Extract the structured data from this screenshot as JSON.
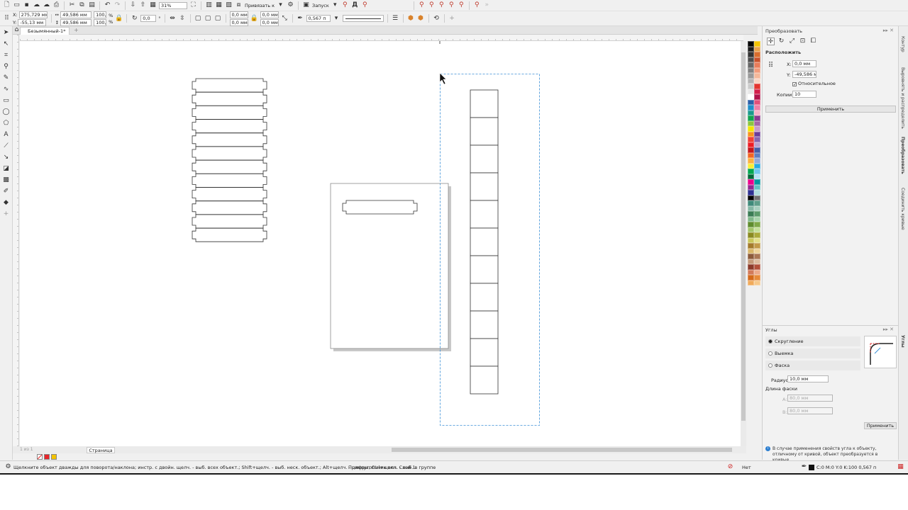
{
  "toolbar1": {
    "zoom": "31%",
    "snap_label": "Привязать к",
    "launch_label": "Запуск"
  },
  "toolbar2": {
    "x_value": "275,729 мм",
    "y_value": "-55,13 мм",
    "width_value": "49,586 мм",
    "height_value": "49,586 мм",
    "scale_w": "100,0",
    "scale_h": "100,0",
    "percent": "%",
    "angle": "0,0",
    "angle_unit": "°",
    "corner1": "0,0 мм",
    "corner2": "0,0 мм",
    "corner3": "0,0 мм",
    "corner4": "0,0 мм",
    "outline_width": "0,567 п"
  },
  "document": {
    "tab_title": "Безымянный-1*",
    "page_tab": "Страница 1",
    "page_nav": "1 из 1"
  },
  "palette_colors": [
    "#000000",
    "#f2c200",
    "#1a1a1a",
    "#e8a04a",
    "#333333",
    "#d96c2c",
    "#4d4d4d",
    "#c8502a",
    "#666666",
    "#e87c5a",
    "#808080",
    "#f09a7a",
    "#999999",
    "#f4b89a",
    "#b3b3b3",
    "#f8d4c4",
    "#cccccc",
    "#e3342f",
    "#e6e6e6",
    "#d21e4a",
    "#ffffff",
    "#b0124a",
    "#2b5fa8",
    "#e14f7a",
    "#1e8fc9",
    "#ee7fa8",
    "#1a9a8c",
    "#f6b3c9",
    "#12a350",
    "#8a3b8f",
    "#8cc63f",
    "#a566a5",
    "#f3e600",
    "#c89fc9",
    "#f7941d",
    "#6a3d99",
    "#ef4136",
    "#8766b0",
    "#ed1c24",
    "#b9a3d1",
    "#c4161c",
    "#445ea8",
    "#f26522",
    "#5e7fc1",
    "#fbb040",
    "#93a9da",
    "#f9ed32",
    "#27aae1",
    "#00a651",
    "#71c8ed",
    "#006838",
    "#b7e2f5",
    "#ec008c",
    "#0098a0",
    "#92278f",
    "#61c2c2",
    "#2e3192",
    "#b0dede",
    "#000000",
    "#707070",
    "#3f8a7a",
    "#5f9e8a",
    "#84b7a4",
    "#a9d0c0",
    "#3a7c54",
    "#5b9b6b",
    "#80b88a",
    "#a7d4ab",
    "#5e8c2d",
    "#7ea848",
    "#a2c56a",
    "#c5e09a",
    "#8a8a20",
    "#aaaa3a",
    "#c9c75a",
    "#e3e08a",
    "#a37a2a",
    "#c29a48",
    "#d9b76a",
    "#eed49a",
    "#8c5a3a",
    "#aa7755",
    "#c49a7a",
    "#dcbca0",
    "#8c3a2a",
    "#b2503a",
    "#d27a5a",
    "#ecaa8a",
    "#d4691a",
    "#e68a3a",
    "#f0aa5a",
    "#f6c88a"
  ],
  "dock": {
    "transform_title": "Преобразовать",
    "arrange_title": "Расположить",
    "x_label": "X:",
    "x_value": "0,0 мм",
    "y_label": "Y:",
    "y_value": "-49,586 мм",
    "relative_label": "Относительное",
    "copies_label": "Копии:",
    "copies_value": "10",
    "apply_label": "Применить",
    "corners_title": "Углы",
    "opt_round": "Скругление",
    "opt_scallop": "Выемка",
    "opt_chamfer": "Фаска",
    "radius_label": "Радиус:",
    "radius_value": "10,0 мм",
    "chamfer_len_label": "Длина фаски",
    "a_label": "A:",
    "a_value": "80,0 мм",
    "b_label": "B:",
    "b_value": "80,0 мм",
    "apply2_label": "Применить",
    "hint_text": "В случае применения свойств угла к объекту, отличному от кривой, объект преобразуется в кривые."
  },
  "vtabs": {
    "tab1": "Контур",
    "tab2": "Выровнять и распределить",
    "tab3": "Преобразовать",
    "tab4": "Соединить кривые",
    "tab5": "Углы"
  },
  "status": {
    "hint": "Щелкните объект дважды для поворота/наклона; инстр. с двойн. щелч. - выб. всех объект.; Shift+щелч. - выб. неск. объект.; Alt+щелч. - цифры; Ctrl+щелч. - выб. в группе",
    "object_info": "Прямоугольник вкл. Слой 1",
    "fill_none": "Нет",
    "outline_info": "C:0 M:0 Y:0 K:100  0,567 п"
  }
}
